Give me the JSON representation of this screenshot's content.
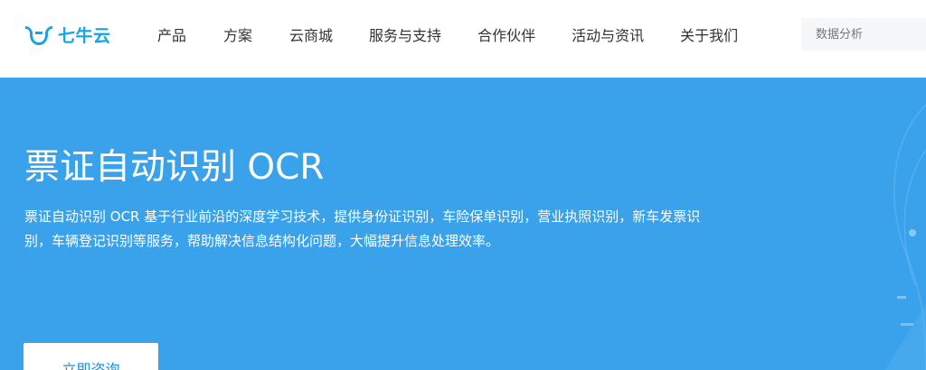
{
  "header": {
    "logo_text": "七牛云",
    "nav": [
      {
        "label": "产品"
      },
      {
        "label": "方案"
      },
      {
        "label": "云商城"
      },
      {
        "label": "服务与支持"
      },
      {
        "label": "合作伙伴"
      },
      {
        "label": "活动与资讯"
      },
      {
        "label": "关于我们"
      }
    ],
    "search": {
      "placeholder": "数据分析",
      "value": ""
    }
  },
  "hero": {
    "title": "票证自动识别 OCR",
    "description": "票证自动识别 OCR 基于行业前沿的深度学习技术，提供身份证识别，车险保单识别，营业执照识别，新车发票识别，车辆登记识别等服务，帮助解决信息结构化问题，大幅提升信息处理效率。",
    "cta_label": "立即咨询"
  },
  "colors": {
    "brand": "#14a3e4",
    "hero_bg": "#3aa1eb",
    "nav_text": "#333333",
    "button_text": "#1f8ee0"
  }
}
